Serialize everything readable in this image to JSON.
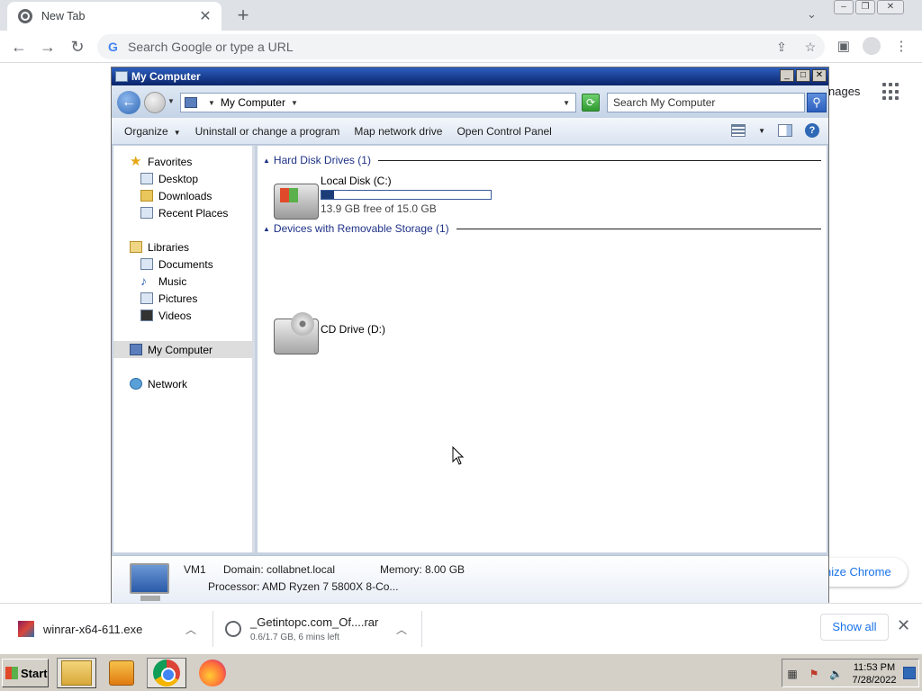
{
  "chrome": {
    "tab_title": "New Tab",
    "omnibox_placeholder": "Search Google or type a URL",
    "ntp_images_text": "nages",
    "customize_label": "nize Chrome"
  },
  "explorer": {
    "title": "My Computer",
    "address": "My Computer",
    "search_placeholder": "Search My Computer",
    "commands": {
      "organize": "Organize",
      "uninstall": "Uninstall or change a program",
      "map_drive": "Map network drive",
      "control_panel": "Open Control Panel"
    },
    "nav": {
      "favorites": "Favorites",
      "desktop": "Desktop",
      "downloads": "Downloads",
      "recent_places": "Recent Places",
      "libraries": "Libraries",
      "documents": "Documents",
      "music": "Music",
      "pictures": "Pictures",
      "videos": "Videos",
      "my_computer": "My Computer",
      "network": "Network"
    },
    "groups": {
      "hdd_header": "Hard Disk Drives (1)",
      "removable_header": "Devices with Removable Storage (1)"
    },
    "drives": {
      "c_name": "Local Disk (C:)",
      "c_free": "13.9 GB free of 15.0 GB",
      "c_used_fraction": 0.073,
      "d_name": "CD Drive (D:)"
    },
    "details": {
      "name": "VM1",
      "domain": "Domain: collabnet.local",
      "memory": "Memory: 8.00 GB",
      "processor": "Processor: AMD Ryzen 7 5800X 8-Co..."
    }
  },
  "downloads": {
    "item1_name": "winrar-x64-611.exe",
    "item2_name": "_Getintopc.com_Of....rar",
    "item2_status": "0.6/1.7 GB, 6 mins left",
    "show_all": "Show all"
  },
  "taskbar": {
    "start_label": "Start",
    "clock_time": "11:53 PM",
    "clock_date": "7/28/2022"
  }
}
